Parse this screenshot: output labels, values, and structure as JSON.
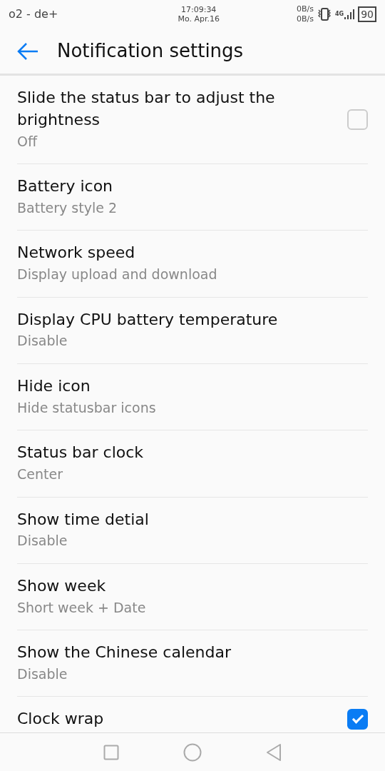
{
  "status_bar": {
    "carrier": "o2 - de+",
    "time": "17:09:34",
    "date": "Mo. Apr.16",
    "upload": "0B/s",
    "download": "0B/s",
    "network": "4G",
    "battery": "90"
  },
  "header": {
    "title": "Notification settings"
  },
  "items": [
    {
      "kind": "checkbox",
      "title": "Slide the status bar to adjust the brightness",
      "summary": "Off",
      "checked": false
    },
    {
      "kind": "text",
      "title": "Battery icon",
      "summary": "Battery style 2"
    },
    {
      "kind": "text",
      "title": "Network speed",
      "summary": "Display upload and download"
    },
    {
      "kind": "text",
      "title": "Display CPU battery temperature",
      "summary": "Disable"
    },
    {
      "kind": "text",
      "title": "Hide icon",
      "summary": "Hide statusbar icons"
    },
    {
      "kind": "text",
      "title": "Status bar clock",
      "summary": "Center"
    },
    {
      "kind": "text",
      "title": "Show time detial",
      "summary": "Disable"
    },
    {
      "kind": "text",
      "title": "Show week",
      "summary": "Short week + Date"
    },
    {
      "kind": "text",
      "title": "Show the Chinese calendar",
      "summary": "Disable"
    },
    {
      "kind": "checkbox",
      "title": "Clock wrap",
      "checked": true
    }
  ]
}
